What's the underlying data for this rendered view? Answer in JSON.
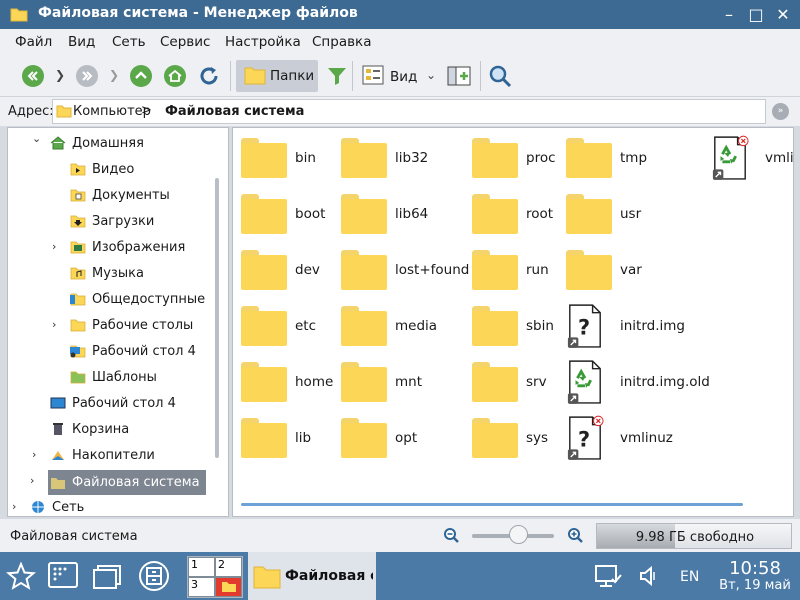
{
  "window": {
    "title": "Файловая система - Менеджер файлов"
  },
  "menu": [
    "Файл",
    "Вид",
    "Сеть",
    "Сервис",
    "Настройка",
    "Справка"
  ],
  "toolbar": {
    "folders_label": "Папки",
    "view_label": "Вид"
  },
  "address": {
    "label": "Адрес:",
    "crumbs": [
      "Компьютер",
      "Файловая система"
    ],
    "separator": ">"
  },
  "tree": [
    {
      "label": "Домашняя",
      "level": 1,
      "expanded": true,
      "icon": "home-icon"
    },
    {
      "label": "Видео",
      "level": 2,
      "icon": "video-folder-icon"
    },
    {
      "label": "Документы",
      "level": 2,
      "icon": "documents-folder-icon"
    },
    {
      "label": "Загрузки",
      "level": 2,
      "icon": "downloads-folder-icon"
    },
    {
      "label": "Изображения",
      "level": 2,
      "expandable": true,
      "icon": "pictures-folder-icon"
    },
    {
      "label": "Музыка",
      "level": 2,
      "icon": "music-folder-icon"
    },
    {
      "label": "Общедоступные",
      "level": 2,
      "icon": "public-folder-icon"
    },
    {
      "label": "Рабочие столы",
      "level": 2,
      "expandable": true,
      "icon": "folder-icon"
    },
    {
      "label": "Рабочий стол 4",
      "level": 2,
      "icon": "desktop-folder-icon"
    },
    {
      "label": "Шаблоны",
      "level": 2,
      "icon": "templates-folder-icon"
    },
    {
      "label": "Рабочий стол 4",
      "level": 1,
      "icon": "desktop-icon"
    },
    {
      "label": "Корзина",
      "level": 1,
      "icon": "trash-icon"
    },
    {
      "label": "Накопители",
      "level": 1,
      "expandable": true,
      "icon": "drives-icon"
    },
    {
      "label": "Файловая система",
      "level": 1,
      "expandable": true,
      "selected": true,
      "icon": "filesystem-icon"
    },
    {
      "label": "Сеть",
      "level": 0,
      "expandable": true,
      "icon": "network-icon"
    }
  ],
  "files": [
    {
      "name": "bin",
      "type": "folder"
    },
    {
      "name": "lib32",
      "type": "folder"
    },
    {
      "name": "proc",
      "type": "folder"
    },
    {
      "name": "tmp",
      "type": "folder"
    },
    {
      "name": "vmlinuz",
      "type": "recycle-broken"
    },
    {
      "name": "boot",
      "type": "folder"
    },
    {
      "name": "lib64",
      "type": "folder"
    },
    {
      "name": "root",
      "type": "folder"
    },
    {
      "name": "usr",
      "type": "folder"
    },
    {
      "name": "dev",
      "type": "folder"
    },
    {
      "name": "lost+found",
      "type": "folder"
    },
    {
      "name": "run",
      "type": "folder"
    },
    {
      "name": "var",
      "type": "folder"
    },
    {
      "name": "etc",
      "type": "folder"
    },
    {
      "name": "media",
      "type": "folder"
    },
    {
      "name": "sbin",
      "type": "folder"
    },
    {
      "name": "initrd.img",
      "type": "unknown-link"
    },
    {
      "name": "home",
      "type": "folder"
    },
    {
      "name": "mnt",
      "type": "folder"
    },
    {
      "name": "srv",
      "type": "folder"
    },
    {
      "name": "initrd.img.old",
      "type": "recycle-link"
    },
    {
      "name": "lib",
      "type": "folder"
    },
    {
      "name": "opt",
      "type": "folder"
    },
    {
      "name": "sys",
      "type": "folder"
    },
    {
      "name": "vmlinuz",
      "type": "unknown-broken"
    }
  ],
  "status": {
    "text": "Файловая система",
    "disk_free": "9.98 ГБ свободно",
    "disk_used_fraction": 0.4
  },
  "taskbar": {
    "pager": [
      "1",
      "2",
      "3"
    ],
    "task_label": "Файловая система - Менеджер файлов",
    "lang": "EN",
    "time": "10:58",
    "date": "Вт, 19 май"
  },
  "colors": {
    "titlebar": "#3d6a92",
    "taskbar": "#4a7aa5",
    "folder": "#fbd657",
    "selection": "#7d8591",
    "accent": "#5ba84a"
  }
}
